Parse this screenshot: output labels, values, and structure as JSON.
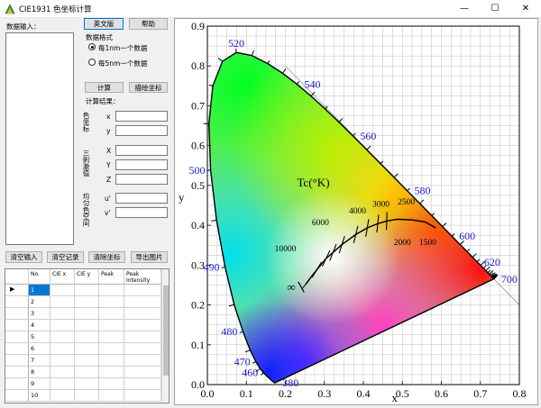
{
  "window": {
    "title": "CIE1931 色坐标计算",
    "minimize_glyph": "—",
    "maximize_glyph": "☐",
    "close_glyph": "✕"
  },
  "left": {
    "data_input_label": "数据输入：",
    "english_button": "英文版",
    "help_button": "帮助",
    "format_label": "数据格式",
    "radio_1nm": "每1nm一个数据",
    "radio_5nm": "每5nm一个数据",
    "compute_button": "计算",
    "plot_button": "描绘坐标",
    "results_label": "计算结果：",
    "group_color_coords": "色坐标",
    "group_tristimulus": "三刺激值",
    "group_ucs": "均匀色空间",
    "field_x": "x",
    "field_y": "y",
    "field_X": "X",
    "field_Y": "Y",
    "field_Z": "Z",
    "field_u": "u'",
    "field_v": "v'",
    "clear_input_button": "清空输入",
    "clear_records_button": "清空记录",
    "clear_coords_button": "清除坐标",
    "export_image_button": "导出图片"
  },
  "table": {
    "headers": [
      "No.",
      "CIE x",
      "CIE y",
      "Peak",
      "Peak Intensity"
    ],
    "rows": [
      "1",
      "2",
      "3",
      "4",
      "5",
      "6",
      "7",
      "8",
      "9",
      "10"
    ],
    "current_row_marker": "▶"
  },
  "chart_data": {
    "type": "scatter",
    "xlabel": "x",
    "ylabel": "y",
    "xlim": [
      0,
      0.8
    ],
    "ylim": [
      0,
      0.9
    ],
    "x_ticks": [
      "0.0",
      "0.1",
      "0.2",
      "0.3",
      "0.4",
      "0.5",
      "0.6",
      "0.7",
      "0.8"
    ],
    "y_ticks": [
      "0.0",
      "0.1",
      "0.2",
      "0.3",
      "0.4",
      "0.5",
      "0.6",
      "0.7",
      "0.8",
      "0.9"
    ],
    "grid": true,
    "locus": [
      [
        0.1741,
        0.005
      ],
      [
        0.1738,
        0.0049
      ],
      [
        0.1736,
        0.0049
      ],
      [
        0.1733,
        0.0048
      ],
      [
        0.173,
        0.0048
      ],
      [
        0.1726,
        0.0048
      ],
      [
        0.1721,
        0.0048
      ],
      [
        0.1714,
        0.0051
      ],
      [
        0.1703,
        0.0058
      ],
      [
        0.1689,
        0.0069
      ],
      [
        0.1669,
        0.0086
      ],
      [
        0.1644,
        0.0109
      ],
      [
        0.1611,
        0.0138
      ],
      [
        0.1566,
        0.0177
      ],
      [
        0.151,
        0.0227
      ],
      [
        0.144,
        0.0297
      ],
      [
        0.1355,
        0.0399
      ],
      [
        0.1241,
        0.0578
      ],
      [
        0.1096,
        0.0868
      ],
      [
        0.0913,
        0.1327
      ],
      [
        0.0687,
        0.2007
      ],
      [
        0.0454,
        0.295
      ],
      [
        0.0235,
        0.4127
      ],
      [
        0.0082,
        0.5384
      ],
      [
        0.0039,
        0.6548
      ],
      [
        0.0139,
        0.7502
      ],
      [
        0.0389,
        0.812
      ],
      [
        0.0743,
        0.8338
      ],
      [
        0.1142,
        0.8262
      ],
      [
        0.1547,
        0.8059
      ],
      [
        0.1929,
        0.7816
      ],
      [
        0.2296,
        0.7543
      ],
      [
        0.2658,
        0.7243
      ],
      [
        0.3016,
        0.6923
      ],
      [
        0.3373,
        0.6589
      ],
      [
        0.3731,
        0.6245
      ],
      [
        0.4087,
        0.5896
      ],
      [
        0.4441,
        0.5547
      ],
      [
        0.4788,
        0.5202
      ],
      [
        0.5125,
        0.4866
      ],
      [
        0.5448,
        0.4544
      ],
      [
        0.5752,
        0.4242
      ],
      [
        0.6029,
        0.3965
      ],
      [
        0.627,
        0.3725
      ],
      [
        0.6482,
        0.3514
      ],
      [
        0.6658,
        0.334
      ],
      [
        0.6801,
        0.3197
      ],
      [
        0.6915,
        0.3083
      ],
      [
        0.7006,
        0.2993
      ],
      [
        0.7079,
        0.292
      ],
      [
        0.714,
        0.2859
      ],
      [
        0.719,
        0.2809
      ],
      [
        0.723,
        0.277
      ],
      [
        0.726,
        0.274
      ],
      [
        0.7283,
        0.2717
      ],
      [
        0.73,
        0.27
      ],
      [
        0.7311,
        0.2689
      ],
      [
        0.732,
        0.268
      ],
      [
        0.7327,
        0.2673
      ],
      [
        0.7334,
        0.2666
      ],
      [
        0.734,
        0.266
      ],
      [
        0.7344,
        0.2656
      ],
      [
        0.7346,
        0.2654
      ],
      [
        0.7347,
        0.2653
      ],
      [
        0.7347,
        0.2653
      ],
      [
        0.7347,
        0.2653
      ]
    ],
    "locus_start_nm": 380,
    "locus_step_nm": 5,
    "wavelength_labels": [
      {
        "text": "380",
        "x": 0.174,
        "y": 0.005,
        "pos": "right"
      },
      {
        "text": "460",
        "x": 0.144,
        "y": 0.03,
        "pos": "left"
      },
      {
        "text": "470",
        "x": 0.124,
        "y": 0.058,
        "pos": "left"
      },
      {
        "text": "480",
        "x": 0.091,
        "y": 0.133,
        "pos": "left"
      },
      {
        "text": "490",
        "x": 0.045,
        "y": 0.295,
        "pos": "left"
      },
      {
        "text": "500",
        "x": 0.008,
        "y": 0.538,
        "pos": "left"
      },
      {
        "text": "520",
        "x": 0.074,
        "y": 0.834,
        "pos": "above"
      },
      {
        "text": "540",
        "x": 0.23,
        "y": 0.754,
        "pos": "right"
      },
      {
        "text": "560",
        "x": 0.373,
        "y": 0.624,
        "pos": "right"
      },
      {
        "text": "580",
        "x": 0.512,
        "y": 0.487,
        "pos": "right"
      },
      {
        "text": "600",
        "x": 0.627,
        "y": 0.373,
        "pos": "right"
      },
      {
        "text": "620",
        "x": 0.691,
        "y": 0.308,
        "pos": "right"
      },
      {
        "text": "700",
        "x": 0.735,
        "y": 0.265,
        "pos": "right"
      }
    ],
    "planckian_locus": [
      [
        0.2525,
        0.2523
      ],
      [
        0.2637,
        0.2671
      ],
      [
        0.2806,
        0.2883
      ],
      [
        0.3044,
        0.3166
      ],
      [
        0.3221,
        0.3318
      ],
      [
        0.3451,
        0.3516
      ],
      [
        0.3805,
        0.3768
      ],
      [
        0.41,
        0.3935
      ],
      [
        0.4369,
        0.4041
      ],
      [
        0.4599,
        0.4106
      ],
      [
        0.4877,
        0.4152
      ],
      [
        0.5266,
        0.4133
      ],
      [
        0.5586,
        0.4081
      ],
      [
        0.586,
        0.3932
      ]
    ],
    "isotherms": [
      {
        "x": 0.2806,
        "y": 0.2883,
        "angle": 58,
        "len": 0.045
      },
      {
        "x": 0.3044,
        "y": 0.3166,
        "angle": 64,
        "len": 0.045
      },
      {
        "x": 0.3221,
        "y": 0.3318,
        "angle": 68,
        "len": 0.045
      },
      {
        "x": 0.3451,
        "y": 0.3516,
        "angle": 72,
        "len": 0.045
      },
      {
        "x": 0.3805,
        "y": 0.3768,
        "angle": 76,
        "len": 0.045
      },
      {
        "x": 0.41,
        "y": 0.3935,
        "angle": 80,
        "len": 0.045
      },
      {
        "x": 0.4369,
        "y": 0.4041,
        "angle": 84,
        "len": 0.045
      },
      {
        "x": 0.4599,
        "y": 0.4106,
        "angle": 88,
        "len": 0.045
      },
      {
        "x": 0.2637,
        "y": 0.2671,
        "angle": 54,
        "len": 0.03
      },
      {
        "x": 0.2525,
        "y": 0.2523,
        "angle": 50,
        "len": 0.025
      }
    ],
    "cct_labels": [
      {
        "text": "10000",
        "x": 0.2,
        "y": 0.335
      },
      {
        "text": "6000",
        "x": 0.29,
        "y": 0.4
      },
      {
        "text": "4000",
        "x": 0.385,
        "y": 0.43
      },
      {
        "text": "3000",
        "x": 0.445,
        "y": 0.447
      },
      {
        "text": "2500",
        "x": 0.51,
        "y": 0.452
      },
      {
        "text": "2000",
        "x": 0.5,
        "y": 0.35
      },
      {
        "text": "1500",
        "x": 0.565,
        "y": 0.35
      },
      {
        "text": "∞",
        "x": 0.215,
        "y": 0.235
      }
    ],
    "cct_title": "Tc(°K)",
    "colors": {
      "wavelength_label": "#1a1acc",
      "locus_stroke": "#000000",
      "grid": "#bfbfbf"
    }
  }
}
